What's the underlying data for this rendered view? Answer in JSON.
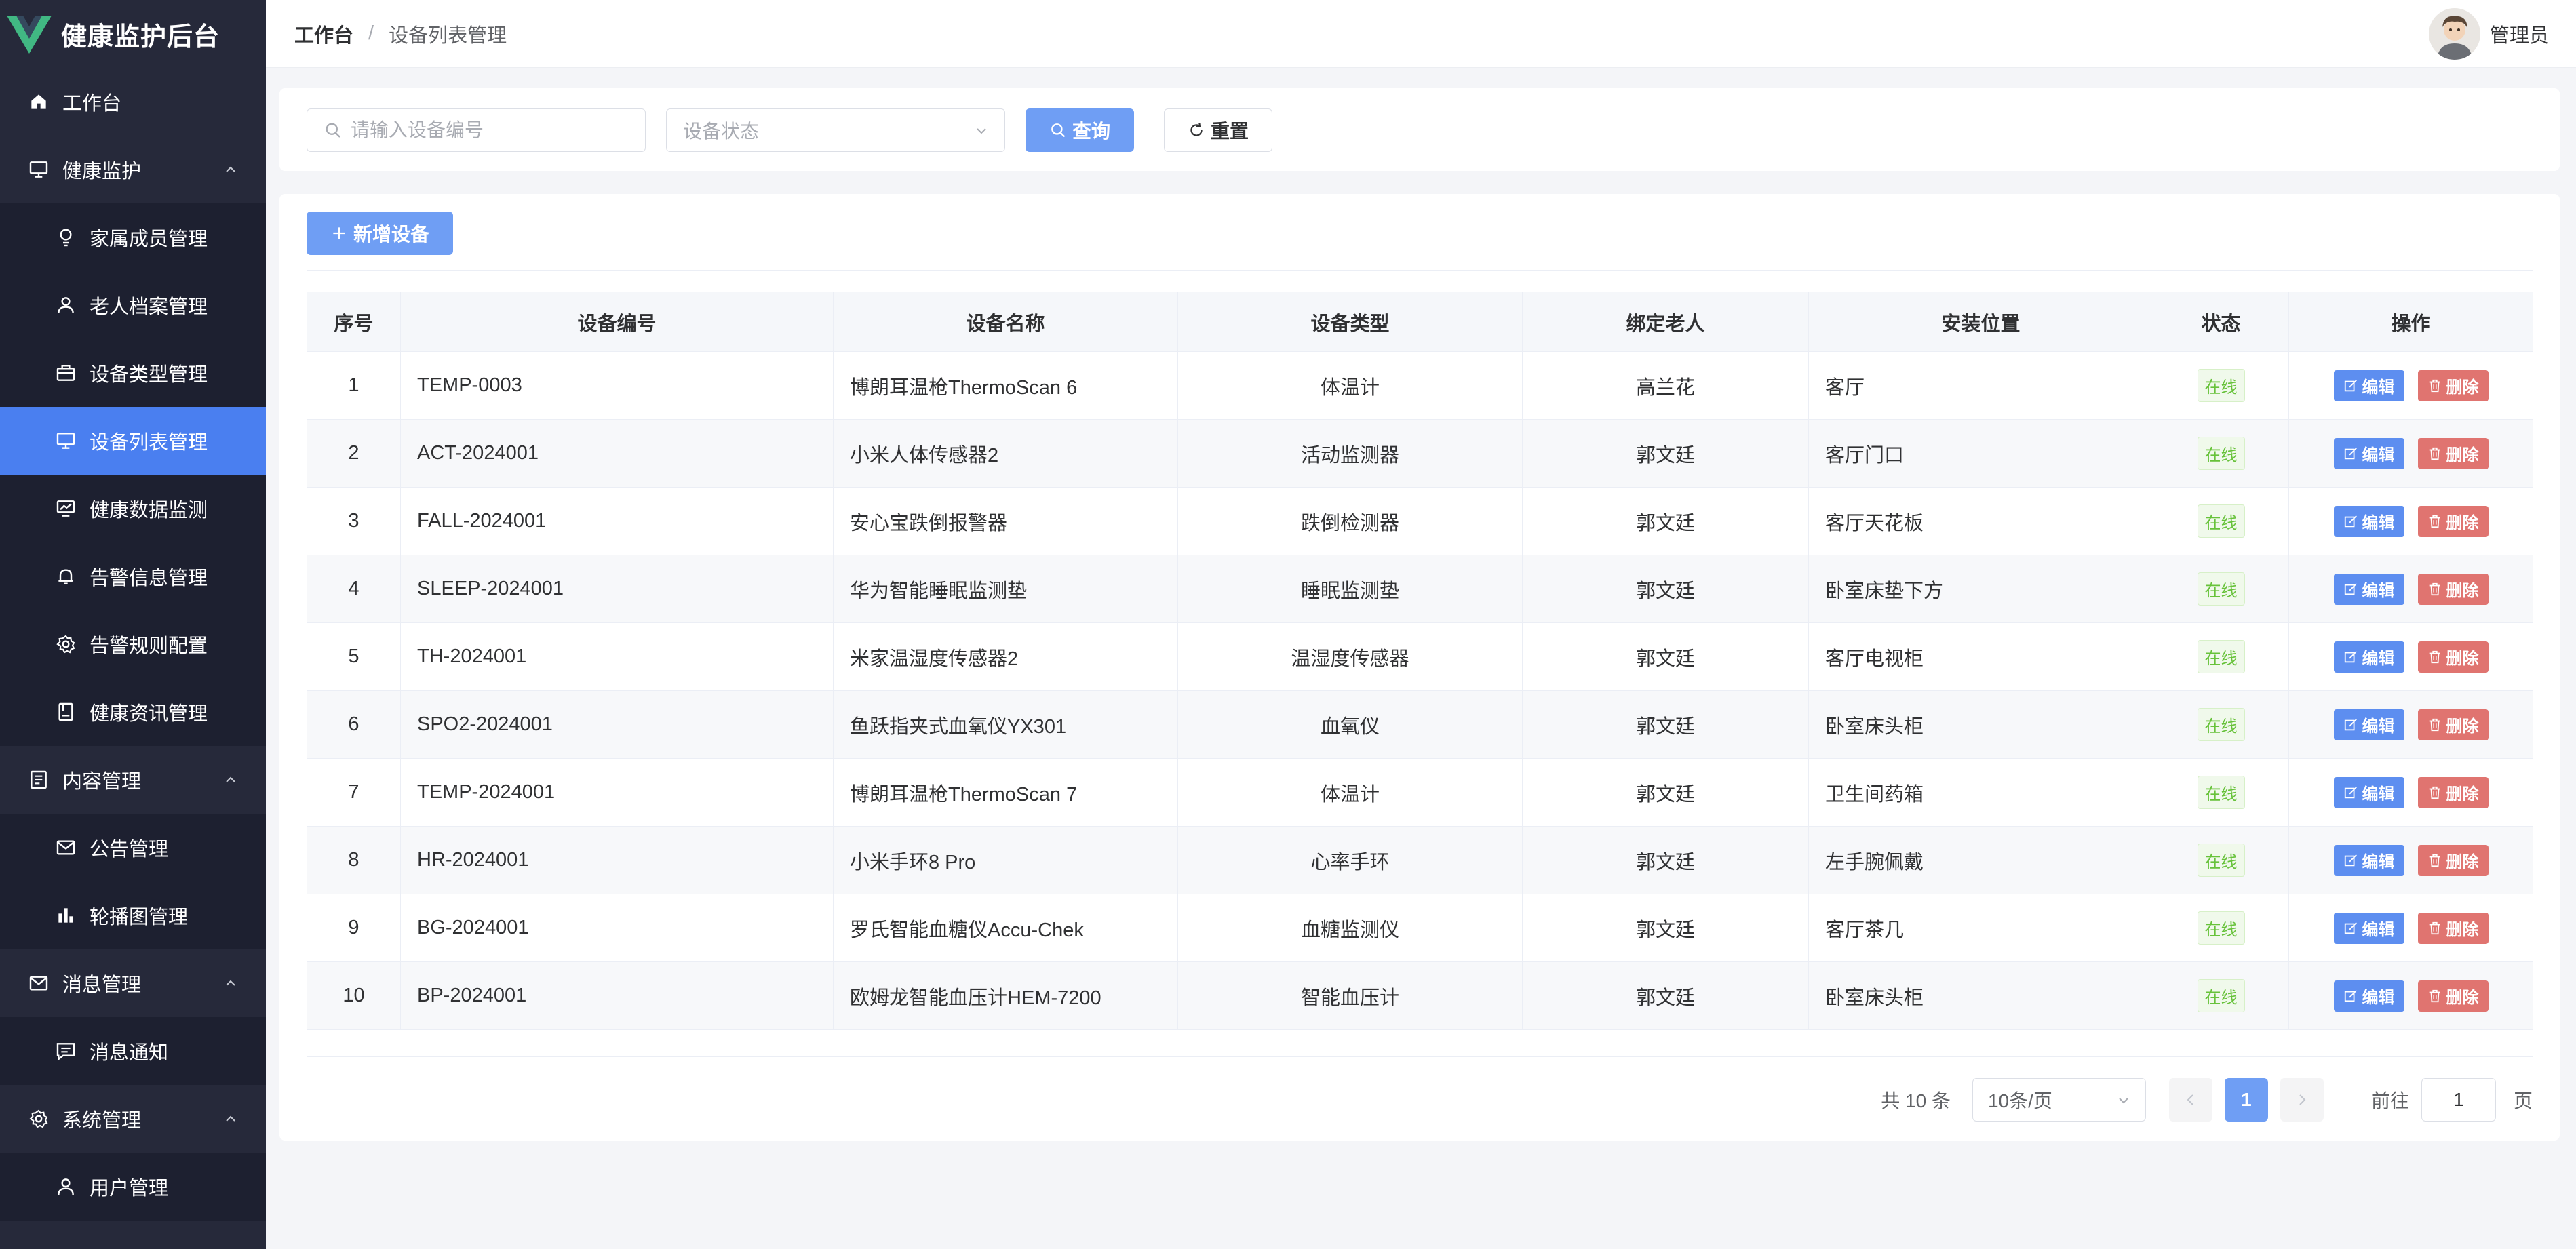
{
  "sidebar": {
    "title": "健康监护后台",
    "items": [
      {
        "label": "工作台",
        "icon": "home-icon",
        "level": 1
      },
      {
        "label": "健康监护",
        "icon": "monitor-icon",
        "level": 1,
        "expanded": true
      },
      {
        "label": "家属成员管理",
        "icon": "lightbulb-icon",
        "level": 2
      },
      {
        "label": "老人档案管理",
        "icon": "user-icon",
        "level": 2
      },
      {
        "label": "设备类型管理",
        "icon": "suitcase-icon",
        "level": 2
      },
      {
        "label": "设备列表管理",
        "icon": "monitor-icon",
        "level": 2,
        "active": true
      },
      {
        "label": "健康数据监测",
        "icon": "chart-monitor-icon",
        "level": 2
      },
      {
        "label": "告警信息管理",
        "icon": "bell-icon",
        "level": 2
      },
      {
        "label": "告警规则配置",
        "icon": "gear-icon",
        "level": 2
      },
      {
        "label": "健康资讯管理",
        "icon": "notebook-icon",
        "level": 2
      },
      {
        "label": "内容管理",
        "icon": "document-icon",
        "level": 1,
        "expanded": true
      },
      {
        "label": "公告管理",
        "icon": "message-icon",
        "level": 2
      },
      {
        "label": "轮播图管理",
        "icon": "histogram-icon",
        "level": 2
      },
      {
        "label": "消息管理",
        "icon": "message-icon",
        "level": 1,
        "expanded": true
      },
      {
        "label": "消息通知",
        "icon": "chat-icon",
        "level": 2
      },
      {
        "label": "系统管理",
        "icon": "gear-icon",
        "level": 1,
        "expanded": true
      },
      {
        "label": "用户管理",
        "icon": "user-icon",
        "level": 2
      }
    ]
  },
  "header": {
    "breadcrumb_home": "工作台",
    "breadcrumb_sep": "/",
    "breadcrumb_current": "设备列表管理",
    "user_name": "管理员"
  },
  "search": {
    "device_no_placeholder": "请输入设备编号",
    "status_placeholder": "设备状态",
    "query_label": "查询",
    "reset_label": "重置"
  },
  "toolbar": {
    "add_label": "新增设备"
  },
  "table": {
    "headers": [
      "序号",
      "设备编号",
      "设备名称",
      "设备类型",
      "绑定老人",
      "安装位置",
      "状态",
      "操作"
    ],
    "edit_label": "编辑",
    "delete_label": "删除",
    "rows": [
      {
        "no": "1",
        "code": "TEMP-0003",
        "name": "博朗耳温枪ThermoScan 6",
        "type": "体温计",
        "elder": "高兰花",
        "location": "客厅",
        "status": "在线"
      },
      {
        "no": "2",
        "code": "ACT-2024001",
        "name": "小米人体传感器2",
        "type": "活动监测器",
        "elder": "郭文廷",
        "location": "客厅门口",
        "status": "在线"
      },
      {
        "no": "3",
        "code": "FALL-2024001",
        "name": "安心宝跌倒报警器",
        "type": "跌倒检测器",
        "elder": "郭文廷",
        "location": "客厅天花板",
        "status": "在线"
      },
      {
        "no": "4",
        "code": "SLEEP-2024001",
        "name": "华为智能睡眠监测垫",
        "type": "睡眠监测垫",
        "elder": "郭文廷",
        "location": "卧室床垫下方",
        "status": "在线"
      },
      {
        "no": "5",
        "code": "TH-2024001",
        "name": "米家温湿度传感器2",
        "type": "温湿度传感器",
        "elder": "郭文廷",
        "location": "客厅电视柜",
        "status": "在线"
      },
      {
        "no": "6",
        "code": "SPO2-2024001",
        "name": "鱼跃指夹式血氧仪YX301",
        "type": "血氧仪",
        "elder": "郭文廷",
        "location": "卧室床头柜",
        "status": "在线"
      },
      {
        "no": "7",
        "code": "TEMP-2024001",
        "name": "博朗耳温枪ThermoScan 7",
        "type": "体温计",
        "elder": "郭文廷",
        "location": "卫生间药箱",
        "status": "在线"
      },
      {
        "no": "8",
        "code": "HR-2024001",
        "name": "小米手环8 Pro",
        "type": "心率手环",
        "elder": "郭文廷",
        "location": "左手腕佩戴",
        "status": "在线"
      },
      {
        "no": "9",
        "code": "BG-2024001",
        "name": "罗氏智能血糖仪Accu-Chek",
        "type": "血糖监测仪",
        "elder": "郭文廷",
        "location": "客厅茶几",
        "status": "在线"
      },
      {
        "no": "10",
        "code": "BP-2024001",
        "name": "欧姆龙智能血压计HEM-7200",
        "type": "智能血压计",
        "elder": "郭文廷",
        "location": "卧室床头柜",
        "status": "在线"
      }
    ]
  },
  "pagination": {
    "total_text": "共 10 条",
    "page_size": "10条/页",
    "current_page": "1",
    "goto_label": "前往",
    "goto_value": "1",
    "page_suffix": "页"
  },
  "colors": {
    "sidebar_bg": "#26293a",
    "submenu_bg": "#1d2030",
    "accent": "#4a7ff0",
    "primary_button": "#6f9ef4",
    "danger_button": "#e07470",
    "success_tag": "#67c23a"
  }
}
